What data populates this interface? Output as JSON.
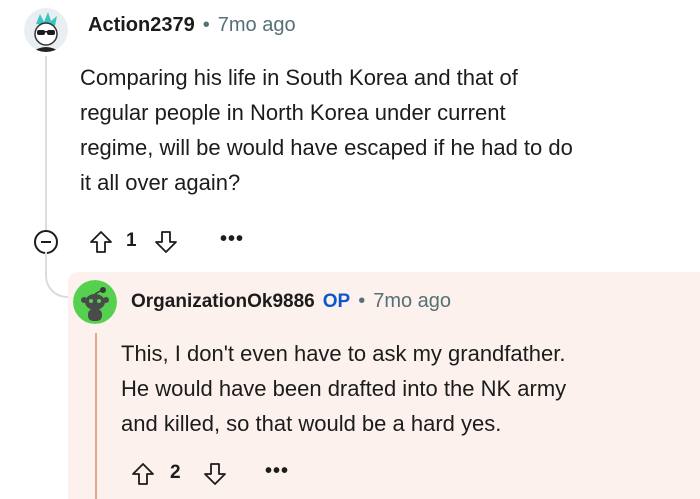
{
  "comment": {
    "author": "Action2379",
    "separator": "•",
    "time": "7mo ago",
    "body_lines": [
      "Comparing his life in South Korea and that of",
      "regular people in North Korea under current",
      "regime, will be would have escaped if he had to do",
      "it all over again?"
    ],
    "score": "1",
    "more_label": "•••"
  },
  "reply": {
    "author": "OrganizationOk9886",
    "op_badge": "OP",
    "separator": "•",
    "time": "7mo ago",
    "body_lines": [
      "This, I don't even have to ask my grandfather.",
      "He would have been drafted into the NK army",
      "and killed, so that would be a hard yes."
    ],
    "score": "2",
    "more_label": "•••"
  },
  "colors": {
    "reply_background": "#fcf1ec",
    "op_badge": "#0a58ca",
    "reply_avatar": "#55d14f",
    "meta_text": "#576f76"
  },
  "icons": [
    "user-avatar-icon",
    "upvote-icon",
    "downvote-icon",
    "more-icon",
    "collapse-icon",
    "snoo-avatar-icon"
  ]
}
